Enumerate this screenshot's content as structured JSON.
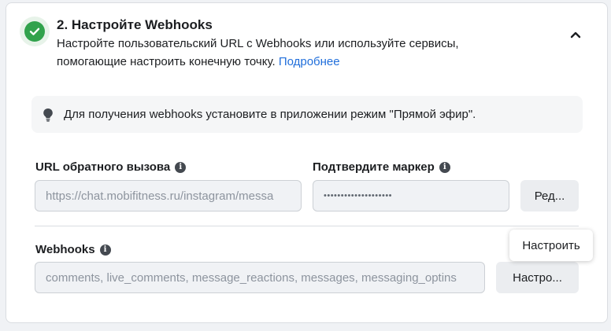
{
  "step": {
    "title": "2. Настройте Webhooks",
    "description": "Настройте пользовательский URL с Webhooks или используйте сервисы, помогающие настроить конечную точку.",
    "learn_more": "Подробнее",
    "status": "complete",
    "colors": {
      "check": "#31a24c",
      "link": "#216fdb"
    }
  },
  "notice": {
    "text": "Для получения webhooks установите в приложении режим \"Прямой эфир\"."
  },
  "callback_url": {
    "label": "URL обратного вызова",
    "value": "https://chat.mobifitness.ru/instagram/messa"
  },
  "verify_token": {
    "label": "Подтвердите маркер",
    "value": "••••••••••••••••••••",
    "edit_button": "Ред..."
  },
  "webhooks": {
    "label": "Webhooks",
    "value": "comments, live_comments, message_reactions, messages, messaging_optins",
    "configure_button": "Настро...",
    "tooltip": "Настроить"
  }
}
